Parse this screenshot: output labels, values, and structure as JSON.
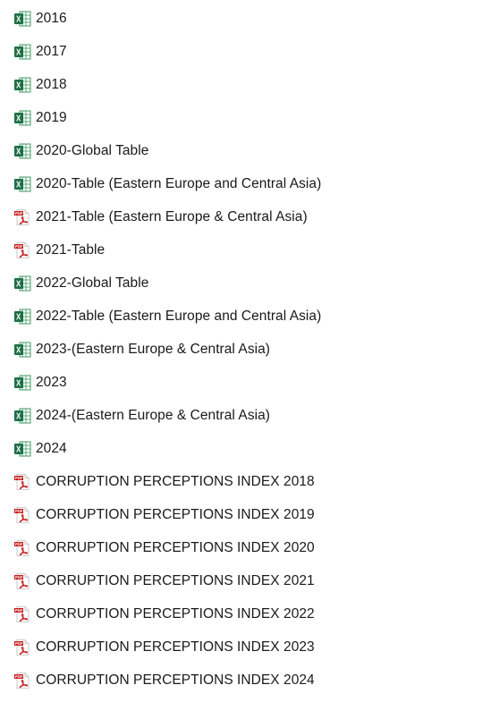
{
  "files": [
    {
      "name": "2016",
      "icon": "excel-icon"
    },
    {
      "name": "2017",
      "icon": "excel-icon"
    },
    {
      "name": "2018",
      "icon": "excel-icon"
    },
    {
      "name": "2019",
      "icon": "excel-icon"
    },
    {
      "name": "2020-Global Table",
      "icon": "excel-icon"
    },
    {
      "name": "2020-Table (Eastern Europe and Central Asia)",
      "icon": "excel-icon"
    },
    {
      "name": "2021-Table (Eastern Europe & Central Asia)",
      "icon": "pdf-icon"
    },
    {
      "name": "2021-Table",
      "icon": "pdf-icon"
    },
    {
      "name": "2022-Global Table",
      "icon": "excel-icon"
    },
    {
      "name": "2022-Table (Eastern Europe and Central Asia)",
      "icon": "excel-icon"
    },
    {
      "name": "2023-(Eastern Europe & Central Asia)",
      "icon": "excel-icon"
    },
    {
      "name": "2023",
      "icon": "excel-icon"
    },
    {
      "name": "2024-(Eastern Europe & Central Asia)",
      "icon": "excel-icon"
    },
    {
      "name": "2024",
      "icon": "excel-icon"
    },
    {
      "name": "CORRUPTION PERCEPTIONS INDEX 2018",
      "icon": "pdf-icon"
    },
    {
      "name": "CORRUPTION PERCEPTIONS INDEX 2019",
      "icon": "pdf-icon"
    },
    {
      "name": "CORRUPTION PERCEPTIONS INDEX 2020",
      "icon": "pdf-icon"
    },
    {
      "name": "CORRUPTION PERCEPTIONS INDEX 2021",
      "icon": "pdf-icon"
    },
    {
      "name": "CORRUPTION PERCEPTIONS INDEX 2022",
      "icon": "pdf-icon"
    },
    {
      "name": "CORRUPTION PERCEPTIONS INDEX 2023",
      "icon": "pdf-icon"
    },
    {
      "name": "CORRUPTION PERCEPTIONS INDEX 2024",
      "icon": "pdf-icon"
    }
  ],
  "colors": {
    "excel_green": "#1d7044",
    "excel_light": "#3c9a62",
    "pdf_red": "#c81e1e"
  }
}
